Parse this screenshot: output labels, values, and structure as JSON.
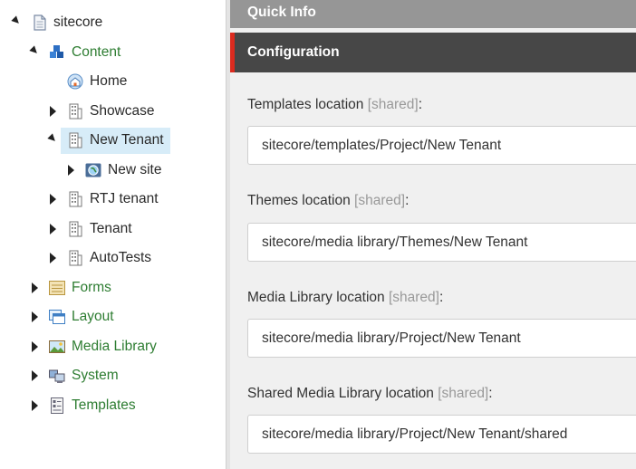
{
  "tree": {
    "root": {
      "label": "sitecore"
    },
    "content": {
      "label": "Content"
    },
    "home": {
      "label": "Home"
    },
    "showcase": {
      "label": "Showcase"
    },
    "new_tenant": {
      "label": "New Tenant"
    },
    "new_site": {
      "label": "New site"
    },
    "rtj_tenant": {
      "label": "RTJ tenant"
    },
    "tenant": {
      "label": "Tenant"
    },
    "autotests": {
      "label": "AutoTests"
    },
    "forms": {
      "label": "Forms"
    },
    "layout": {
      "label": "Layout"
    },
    "media_library": {
      "label": "Media Library"
    },
    "system": {
      "label": "System"
    },
    "templates": {
      "label": "Templates"
    }
  },
  "panel": {
    "quick_info": "Quick Info",
    "configuration": "Configuration",
    "fields": [
      {
        "label": "Templates location",
        "shared": "[shared]",
        "colon": ":",
        "value": "sitecore/templates/Project/New Tenant"
      },
      {
        "label": "Themes location",
        "shared": "[shared]",
        "colon": ":",
        "value": "sitecore/media library/Themes/New Tenant"
      },
      {
        "label": "Media Library location",
        "shared": "[shared]",
        "colon": ":",
        "value": "sitecore/media library/Project/New Tenant"
      },
      {
        "label": "Shared Media Library location",
        "shared": "[shared]",
        "colon": ":",
        "value": "sitecore/media library/Project/New Tenant/shared"
      }
    ]
  },
  "colors": {
    "accent": "#dc2b1f",
    "tree_green": "#2e7d32",
    "selected": "#d7ecf8"
  }
}
